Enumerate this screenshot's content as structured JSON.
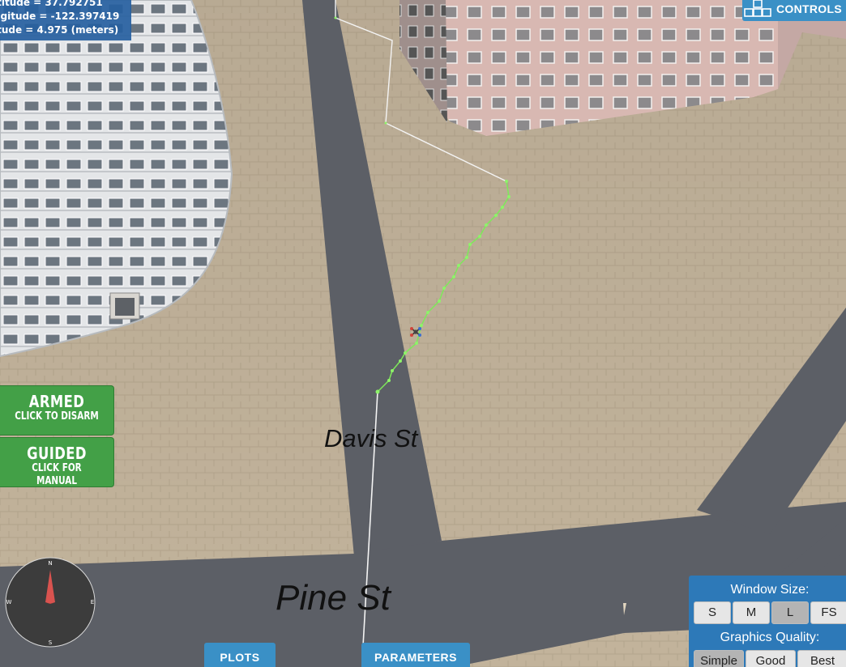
{
  "gps": {
    "latitude_text": "ltitude = 37.792751",
    "longitude_text": "ngitude = -122.397419",
    "altitude_text": "itude = 4.975 (meters)"
  },
  "controls": {
    "label": "CONTROLS",
    "icon": "keyboard-icon"
  },
  "mode_buttons": {
    "armed": {
      "title": "ARMED",
      "subtitle": "CLICK TO DISARM"
    },
    "guided": {
      "title": "GUIDED",
      "subtitle": "CLICK FOR MANUAL"
    }
  },
  "compass": {
    "n": "N",
    "s": "S",
    "e": "E",
    "w": "W"
  },
  "streets": {
    "davis": "Davis St",
    "pine": "Pine St"
  },
  "tabs": {
    "plots": "PLOTS",
    "parameters": "PARAMETERS"
  },
  "settings": {
    "window_size_label": "Window Size:",
    "window_sizes": [
      "S",
      "M",
      "L",
      "FS"
    ],
    "window_size_selected": "L",
    "graphics_quality_label": "Graphics Quality:",
    "graphics_qualities": [
      "Simple",
      "Good",
      "Best"
    ],
    "graphics_quality_selected": "Simple"
  },
  "colors": {
    "panel_blue": "#2d79b8",
    "button_blue": "#3a90c6",
    "armed_green": "#43a047",
    "path_green": "#7ee85a",
    "road_gray": "#5c5f66"
  }
}
